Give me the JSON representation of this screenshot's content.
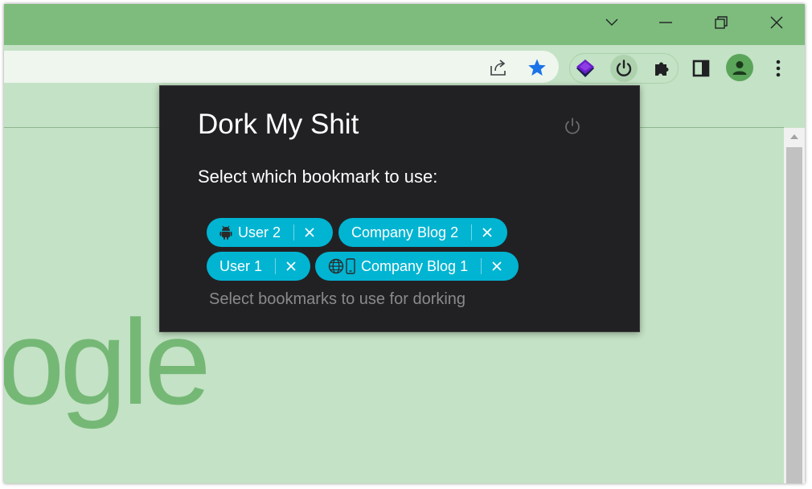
{
  "browser": {
    "logo_text": "ogle",
    "colors": {
      "titlebar": "#7dbc7d",
      "toolbar": "#c4e2c5",
      "omnibox": "#eef6ee",
      "star": "#1a73e8"
    },
    "icons": {
      "share": "share-icon",
      "bookmark": "star-icon",
      "ext1": "layers-icon",
      "ext2": "power-icon",
      "extensions": "puzzle-icon",
      "side_panel": "side-panel-icon",
      "profile": "avatar-icon",
      "menu": "kebab-menu-icon"
    }
  },
  "popup": {
    "title": "Dork My Shit",
    "subtitle": "Select which bookmark to use:",
    "placeholder": "Select bookmarks to use for dorking",
    "colors": {
      "background": "#212124",
      "chip": "#00b4d2"
    },
    "chips": [
      {
        "label": "User 2",
        "icons": [
          "android-icon"
        ]
      },
      {
        "label": "Company Blog 2",
        "icons": []
      },
      {
        "label": "User 1",
        "icons": []
      },
      {
        "label": "Company Blog 1",
        "icons": [
          "globe-icon",
          "mobile-phone-icon"
        ]
      }
    ]
  }
}
